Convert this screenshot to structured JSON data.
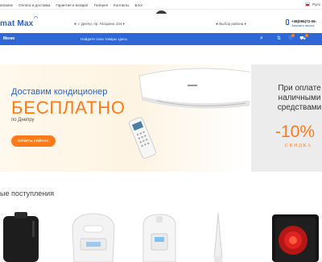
{
  "topbar": {
    "links": [
      "агазине",
      "Оплата и доставка",
      "Гарантия и возврат",
      "Галерея",
      "Контакты",
      "Блог"
    ],
    "lang": "Русс"
  },
  "header": {
    "logo": "mat Max",
    "address": "г. Днепр, пр. Гагарина 104 ▾",
    "city": "Выбор района ▾",
    "phone": "+38(095)72-06-",
    "phone_sub": "Заказать звонок"
  },
  "navbar": {
    "menu_label": "Меню",
    "search_placeholder": "Найдите свои товары здесь"
  },
  "hero": {
    "title": "Доставим кондиционер",
    "big": "БЕСПЛАТНО",
    "sub": "по Днепру",
    "button": "КУПИТЬ СЕЙЧАС"
  },
  "side_promo": {
    "text": "При оплате наличными средствами",
    "percent": "-10%",
    "label": "СКИДКА"
  },
  "section": {
    "title": "ые поступления"
  },
  "colors": {
    "brand_blue": "#2f67d7",
    "accent_orange": "#ff7a1a"
  }
}
